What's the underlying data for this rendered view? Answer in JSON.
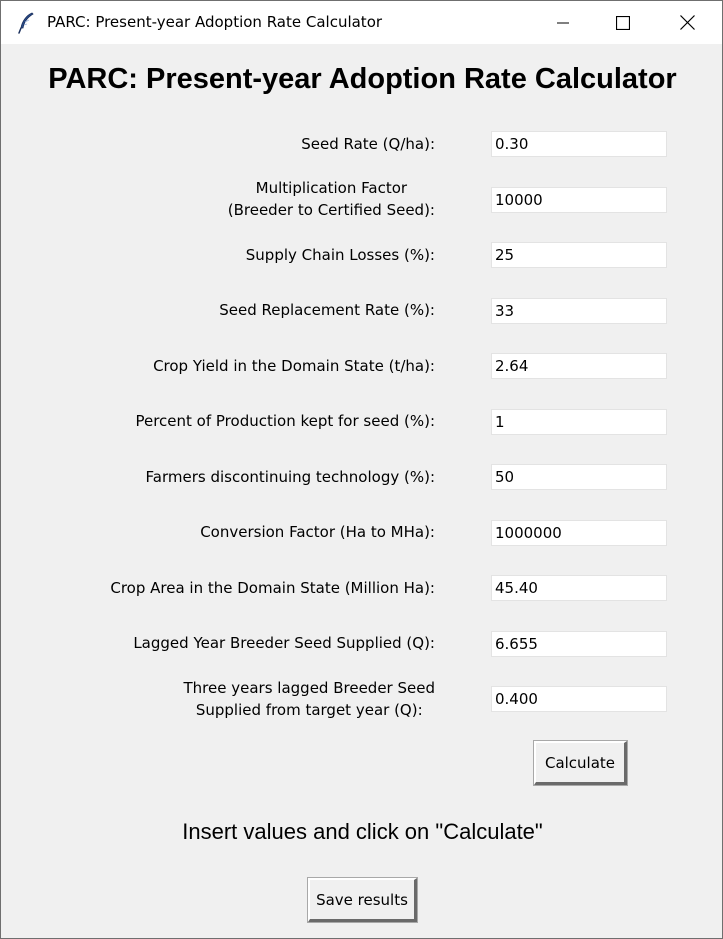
{
  "window": {
    "title": "PARC: Present-year Adoption Rate Calculator"
  },
  "heading": "PARC: Present-year Adoption Rate Calculator",
  "fields": [
    {
      "label_lines": [
        "Seed Rate (Q/ha):"
      ],
      "value": "0.30"
    },
    {
      "label_lines": [
        "Multiplication Factor",
        "(Breeder to Certified Seed):"
      ],
      "value": "10000"
    },
    {
      "label_lines": [
        "Supply Chain Losses (%):"
      ],
      "value": "25"
    },
    {
      "label_lines": [
        "Seed Replacement Rate (%):"
      ],
      "value": "33"
    },
    {
      "label_lines": [
        "Crop Yield in the Domain State (t/ha):"
      ],
      "value": "2.64"
    },
    {
      "label_lines": [
        "Percent of Production kept for seed (%):"
      ],
      "value": "1"
    },
    {
      "label_lines": [
        "Farmers discontinuing technology (%):"
      ],
      "value": "50"
    },
    {
      "label_lines": [
        "Conversion Factor (Ha to MHa):"
      ],
      "value": "1000000"
    },
    {
      "label_lines": [
        "Crop Area in the Domain State (Million Ha):"
      ],
      "value": "45.40"
    },
    {
      "label_lines": [
        "Lagged Year Breeder Seed Supplied (Q):"
      ],
      "value": "6.655"
    },
    {
      "label_lines": [
        "Three years lagged Breeder Seed",
        "Supplied from target year (Q):"
      ],
      "value": "0.400"
    }
  ],
  "buttons": {
    "calculate": "Calculate",
    "save": "Save results"
  },
  "status_text": "Insert values and click on \"Calculate\""
}
